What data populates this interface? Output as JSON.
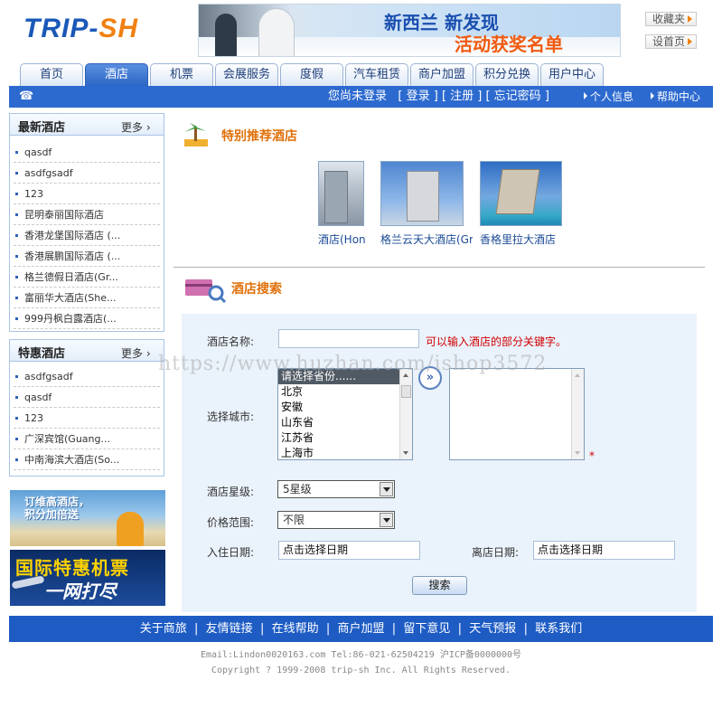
{
  "header": {
    "logo_part1": "TRIP-",
    "logo_part2": "SH",
    "banner_line1": "新西兰  新发现",
    "banner_line2": "活动获奖名单",
    "favorites": "收藏夹",
    "set_homepage": "设首页"
  },
  "tabs": [
    "首页",
    "酒店",
    "机票",
    "会展服务",
    "度假",
    "汽车租赁",
    "商户加盟",
    "积分兑换",
    "用户中心"
  ],
  "navbar": {
    "phone_icon": "☎",
    "login_text": "您尚未登录   [ 登录 ] [ 注册 ] [ 忘记密码 ]",
    "personal": "个人信息",
    "help": "帮助中心"
  },
  "sidebar": {
    "latest": {
      "title": "最新酒店",
      "more": "更多",
      "items": [
        "qasdf",
        "asdfgsadf",
        "123",
        "昆明泰丽国际酒店",
        "香港龙堡国际酒店 (...",
        "香港展鹏国际酒店 (...",
        "格兰德假日酒店(Gr...",
        "富丽华大酒店(She...",
        "999丹枫白露酒店(..."
      ]
    },
    "special": {
      "title": "特惠酒店",
      "more": "更多",
      "items": [
        "asdfgsadf",
        "qasdf",
        "123",
        "广深宾馆(Guang...",
        "中南海滨大酒店(So..."
      ]
    },
    "ad1": "订维高酒店，\n积分加倍送",
    "ad2_line1": "国际特惠机票",
    "ad2_line2": "一网打尽"
  },
  "recommend": {
    "title": "特别推荐酒店",
    "hotels": [
      "酒店(Hong",
      "格兰云天大酒店(Gr",
      "香格里拉大酒店"
    ]
  },
  "search": {
    "title": "酒店搜索",
    "name_label": "酒店名称:",
    "name_value": "",
    "name_hint": "可以输入酒店的部分关键字。",
    "city_label": "选择城市:",
    "cities": [
      "请选择省份......",
      "北京",
      "安徽",
      "山东省",
      "江苏省",
      "上海市"
    ],
    "move_button": "»",
    "required_mark": "*",
    "star_label": "酒店星级:",
    "star_value": "5星级",
    "price_label": "价格范围:",
    "price_value": "不限",
    "checkin_label": "入住日期:",
    "checkin_value": "点击选择日期",
    "checkout_label": "离店日期:",
    "checkout_value": "点击选择日期",
    "search_button": "搜索"
  },
  "footer": {
    "links": "关于商旅  |  友情链接  |  在线帮助  |  商户加盟  |  留下意见  |  天气预报  |  联系我们",
    "contact": "Email:Lindon0020163.com Tel:86-021-62504219 沪ICP备0000000号",
    "copyright": "Copyright ? 1999-2008 trip-sh Inc. All Rights Reserved."
  },
  "watermark": "https://www.huzhan.com/ishop3572",
  "colors": {
    "primary": "#2c6ad0",
    "accent": "#e0700a",
    "hint": "#d00000"
  }
}
